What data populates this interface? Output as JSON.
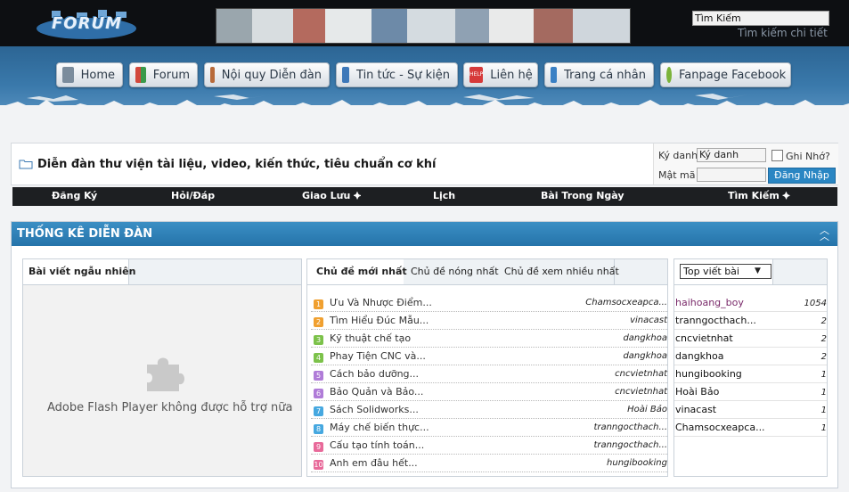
{
  "header": {
    "logo_text": "FORUM",
    "search_value": "Tìm Kiếm",
    "advanced_search": "Tìm kiếm chi tiết"
  },
  "nav": [
    {
      "label": "Home",
      "icon": "home-icon",
      "color": "#7b8c9c"
    },
    {
      "label": "Forum",
      "icon": "forum-blocks-icon",
      "color": "#d2483c"
    },
    {
      "label": "Nội quy Diễn đàn",
      "icon": "rules-icon",
      "color": "#b86a3a"
    },
    {
      "label": "Tin tức - Sự kiện",
      "icon": "news-icon",
      "color": "#3d78b9"
    },
    {
      "label": "Liên hệ",
      "icon": "help-icon",
      "color": "#d63a3a"
    },
    {
      "label": "Trang cá nhân",
      "icon": "profile-icon",
      "color": "#3a80c4"
    },
    {
      "label": "Fanpage Facebook",
      "icon": "facebook-ring-icon",
      "color": "#7bb33a"
    }
  ],
  "site_title": "Diễn đàn thư viện tài liệu, video, kiến thức, tiêu chuẩn cơ khí",
  "login": {
    "username_label": "Ký danh",
    "username_value": "Ký danh",
    "remember_label": "Ghi Nhớ?",
    "password_label": "Mật mã",
    "password_value": "",
    "button": "Đăng Nhập"
  },
  "menu": [
    "Đăng Ký",
    "Hỏi/Đáp",
    "Giao Lưu ⯌",
    "Lịch",
    "Bài Trong Ngày",
    "Tìm Kiếm ⯌"
  ],
  "stats": {
    "title": "THỐNG KÊ DIỄN ĐÀN",
    "left_tab": "Bài viết ngẫu nhiên",
    "flash_message": "Adobe Flash Player không được hỗ trợ nữa",
    "tabs": [
      "Chủ đề mới nhất",
      "Chủ đề nóng nhất",
      "Chủ đề xem nhiều nhất"
    ],
    "topics": [
      {
        "rank": "1",
        "title": "Ưu Và Nhược Điểm...",
        "user": "Chamsocxeapca...",
        "color": "#f0a030"
      },
      {
        "rank": "2",
        "title": "Tìm Hiểu Đúc Mẫu...",
        "user": "vinacast",
        "color": "#f0a030"
      },
      {
        "rank": "3",
        "title": "Kỹ thuật chế tạo",
        "user": "dangkhoa",
        "color": "#7cc24a"
      },
      {
        "rank": "4",
        "title": "Phay Tiện CNC và...",
        "user": "dangkhoa",
        "color": "#7cc24a"
      },
      {
        "rank": "5",
        "title": "Cách bảo dưỡng...",
        "user": "cncvietnhat",
        "color": "#b07cd8"
      },
      {
        "rank": "6",
        "title": "Bảo Quản và Bảo...",
        "user": "cncvietnhat",
        "color": "#b07cd8"
      },
      {
        "rank": "7",
        "title": "Sách Solidworks...",
        "user": "Hoài Bảo",
        "color": "#46a8e0"
      },
      {
        "rank": "8",
        "title": "Máy chế biến thực...",
        "user": "tranngocthach...",
        "color": "#46a8e0"
      },
      {
        "rank": "9",
        "title": "Cấu tạo tính toán...",
        "user": "tranngocthach...",
        "color": "#e86a9a"
      },
      {
        "rank": "10",
        "title": "Anh em đâu hết...",
        "user": "hungibooking",
        "color": "#e86a9a"
      }
    ],
    "top_select": "Top viết bài",
    "top_users": [
      {
        "name": "haihoang_boy",
        "count": "1054",
        "color": "#7a2a6a"
      },
      {
        "name": "tranngocthach...",
        "count": "2",
        "color": "#111111"
      },
      {
        "name": "cncvietnhat",
        "count": "2",
        "color": "#111111"
      },
      {
        "name": "dangkhoa",
        "count": "2",
        "color": "#111111"
      },
      {
        "name": "hungibooking",
        "count": "1",
        "color": "#111111"
      },
      {
        "name": "Hoài Bảo",
        "count": "1",
        "color": "#111111"
      },
      {
        "name": "vinacast",
        "count": "1",
        "color": "#111111"
      },
      {
        "name": "Chamsocxeapca...",
        "count": "1",
        "color": "#111111"
      }
    ]
  }
}
